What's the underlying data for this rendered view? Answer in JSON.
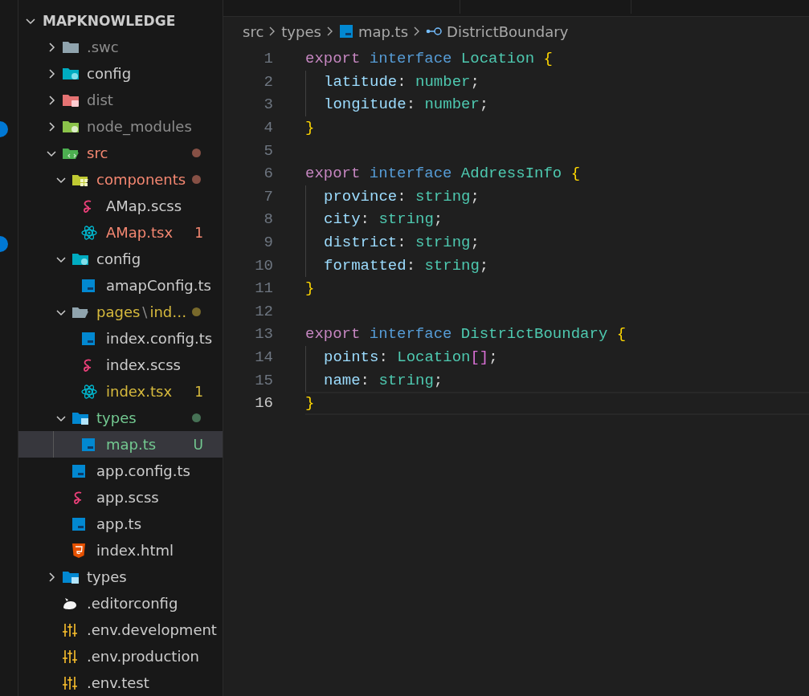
{
  "explorer": {
    "root": {
      "label": "MAPKNOWLEDGE",
      "expanded": true
    },
    "tree": [
      {
        "label": ".swc",
        "kind": "plainfolder",
        "color": "#8c8c8c",
        "expanded": false,
        "selected": false
      },
      {
        "label": "config",
        "kind": "configfolder",
        "color": "#cccccc",
        "expanded": false,
        "selected": false
      },
      {
        "label": "dist",
        "kind": "distfolder",
        "color": "#8c8c8c",
        "expanded": false,
        "selected": false
      },
      {
        "label": "node_modules",
        "kind": "nodefolder",
        "color": "#8c8c8c",
        "expanded": false,
        "selected": false
      },
      {
        "label": "src",
        "kind": "srcfolder",
        "color": "#f48771",
        "expanded": true,
        "dot": true,
        "selected": false,
        "children": [
          {
            "label": "components",
            "kind": "componentsfolder",
            "color": "#f48771",
            "expanded": true,
            "dot": true,
            "selected": false,
            "children": [
              {
                "label": "AMap.scss",
                "kind": "scssfile",
                "color": "#cccccc",
                "selected": false
              },
              {
                "label": "AMap.tsx",
                "kind": "reactfile",
                "color": "#f48771",
                "badge": "1",
                "selected": false
              }
            ]
          },
          {
            "label": "config",
            "kind": "configfolder",
            "color": "#cccccc",
            "expanded": true,
            "selected": false,
            "children": [
              {
                "label": "amapConfig.ts",
                "kind": "tsfile",
                "color": "#cccccc",
                "selected": false
              }
            ]
          },
          {
            "label": "pages",
            "tail": "ind…",
            "separator": "\\",
            "kind": "pagesfolder",
            "color": "#d7ba3d",
            "expanded": true,
            "dot": true,
            "selected": false,
            "children": [
              {
                "label": "index.config.ts",
                "kind": "tsfile",
                "color": "#cccccc",
                "selected": false
              },
              {
                "label": "index.scss",
                "kind": "scssfile",
                "color": "#cccccc",
                "selected": false
              },
              {
                "label": "index.tsx",
                "kind": "reactfile",
                "color": "#d7ba3d",
                "badge": "1",
                "selected": false
              }
            ]
          },
          {
            "label": "types",
            "kind": "typesfolder",
            "color": "#73c991",
            "expanded": true,
            "dot": true,
            "selected": false,
            "children": [
              {
                "label": "map.ts",
                "kind": "tsfile",
                "color": "#73c991",
                "badge": "U",
                "selected": true
              }
            ]
          },
          {
            "label": "app.config.ts",
            "kind": "tsfile",
            "color": "#cccccc",
            "selected": false
          },
          {
            "label": "app.scss",
            "kind": "scssfile",
            "color": "#cccccc",
            "selected": false
          },
          {
            "label": "app.ts",
            "kind": "tsfile",
            "color": "#cccccc",
            "selected": false
          },
          {
            "label": "index.html",
            "kind": "htmlfile",
            "color": "#cccccc",
            "selected": false
          }
        ]
      },
      {
        "label": "types",
        "kind": "typesfolder",
        "color": "#cccccc",
        "expanded": false,
        "selected": false
      },
      {
        "label": ".editorconfig",
        "kind": "editorconfigfile",
        "color": "#cccccc",
        "selected": false
      },
      {
        "label": ".env.development",
        "kind": "envfile",
        "color": "#cccccc",
        "selected": false
      },
      {
        "label": ".env.production",
        "kind": "envfile",
        "color": "#cccccc",
        "selected": false
      },
      {
        "label": ".env.test",
        "kind": "envfile",
        "color": "#cccccc",
        "selected": false
      }
    ]
  },
  "breadcrumb": [
    {
      "label": "src",
      "kind": "folder"
    },
    {
      "label": "types",
      "kind": "folder"
    },
    {
      "label": "map.ts",
      "kind": "tsfile"
    },
    {
      "label": "DistrictBoundary",
      "kind": "symbol"
    }
  ],
  "editor": {
    "lines": [
      {
        "number": "1",
        "indent": false,
        "current": false,
        "tokens": [
          {
            "kind": "keyword",
            "text": "export"
          },
          {
            "kind": "storage",
            "text": " interface"
          },
          {
            "kind": "type",
            "text": " Location"
          },
          {
            "kind": "brace",
            "text": " {"
          }
        ]
      },
      {
        "number": "2",
        "indent": true,
        "current": false,
        "tokens": [
          {
            "kind": "property",
            "text": "latitude"
          },
          {
            "kind": "punct",
            "text": ": "
          },
          {
            "kind": "type",
            "text": "number"
          },
          {
            "kind": "punct",
            "text": ";"
          }
        ]
      },
      {
        "number": "3",
        "indent": true,
        "current": false,
        "tokens": [
          {
            "kind": "property",
            "text": "longitude"
          },
          {
            "kind": "punct",
            "text": ": "
          },
          {
            "kind": "type",
            "text": "number"
          },
          {
            "kind": "punct",
            "text": ";"
          }
        ]
      },
      {
        "number": "4",
        "indent": false,
        "current": false,
        "tokens": [
          {
            "kind": "brace",
            "text": "}"
          }
        ]
      },
      {
        "number": "5",
        "indent": false,
        "current": false
      },
      {
        "number": "6",
        "indent": false,
        "current": false,
        "tokens": [
          {
            "kind": "keyword",
            "text": "export"
          },
          {
            "kind": "storage",
            "text": " interface"
          },
          {
            "kind": "type",
            "text": " AddressInfo"
          },
          {
            "kind": "brace",
            "text": " {"
          }
        ]
      },
      {
        "number": "7",
        "indent": true,
        "current": false,
        "tokens": [
          {
            "kind": "property",
            "text": "province"
          },
          {
            "kind": "punct",
            "text": ": "
          },
          {
            "kind": "type",
            "text": "string"
          },
          {
            "kind": "punct",
            "text": ";"
          }
        ]
      },
      {
        "number": "8",
        "indent": true,
        "current": false,
        "tokens": [
          {
            "kind": "property",
            "text": "city"
          },
          {
            "kind": "punct",
            "text": ": "
          },
          {
            "kind": "type",
            "text": "string"
          },
          {
            "kind": "punct",
            "text": ";"
          }
        ]
      },
      {
        "number": "9",
        "indent": true,
        "current": false,
        "tokens": [
          {
            "kind": "property",
            "text": "district"
          },
          {
            "kind": "punct",
            "text": ": "
          },
          {
            "kind": "type",
            "text": "string"
          },
          {
            "kind": "punct",
            "text": ";"
          }
        ]
      },
      {
        "number": "10",
        "indent": true,
        "current": false,
        "tokens": [
          {
            "kind": "property",
            "text": "formatted"
          },
          {
            "kind": "punct",
            "text": ": "
          },
          {
            "kind": "type",
            "text": "string"
          },
          {
            "kind": "punct",
            "text": ";"
          }
        ]
      },
      {
        "number": "11",
        "indent": false,
        "current": false,
        "tokens": [
          {
            "kind": "brace",
            "text": "}"
          }
        ]
      },
      {
        "number": "12",
        "indent": false,
        "current": false
      },
      {
        "number": "13",
        "indent": false,
        "current": false,
        "tokens": [
          {
            "kind": "keyword",
            "text": "export"
          },
          {
            "kind": "storage",
            "text": " interface"
          },
          {
            "kind": "type",
            "text": " DistrictBoundary"
          },
          {
            "kind": "brace",
            "text": " {"
          }
        ]
      },
      {
        "number": "14",
        "indent": true,
        "current": false,
        "tokens": [
          {
            "kind": "property",
            "text": "points"
          },
          {
            "kind": "punct",
            "text": ": "
          },
          {
            "kind": "type",
            "text": "Location"
          },
          {
            "kind": "bracket",
            "text": "[]"
          },
          {
            "kind": "punct",
            "text": ";"
          }
        ]
      },
      {
        "number": "15",
        "indent": true,
        "current": false,
        "tokens": [
          {
            "kind": "property",
            "text": "name"
          },
          {
            "kind": "punct",
            "text": ": "
          },
          {
            "kind": "type",
            "text": "string"
          },
          {
            "kind": "punct",
            "text": ";"
          }
        ]
      },
      {
        "number": "16",
        "indent": false,
        "current": true,
        "tokens": [
          {
            "kind": "brace",
            "text": "}"
          }
        ]
      }
    ]
  }
}
